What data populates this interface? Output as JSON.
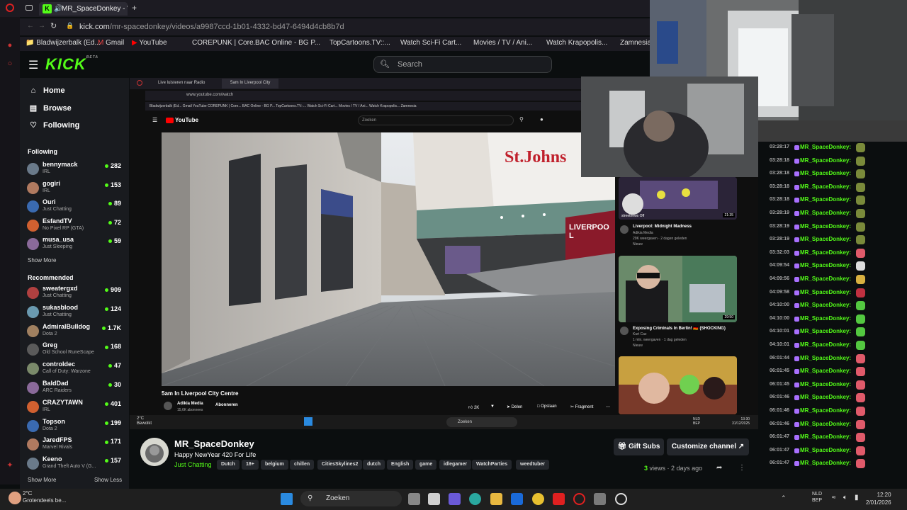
{
  "browser": {
    "tab_title": "MR_SpaceDonkey - W",
    "url_host": "kick.com",
    "url_path": "/mr-spacedonkey/videos/a9987ccd-1b01-4332-bd47-6494d4cb8b7d",
    "bookmarks": [
      "Bladwijzerbalk (Ed...",
      "Gmail",
      "YouTube",
      "COREPUNK | Core...",
      "BAC Online - BG P...",
      "TopCartoons.TV::...",
      "Watch Sci-Fi Cart...",
      "Movies / TV / Ani...",
      "Watch Krapopolis...",
      "Zamnesia |"
    ]
  },
  "header": {
    "logo": "KICK",
    "logo_badge": "BETA",
    "search_placeholder": "Search"
  },
  "sidebar": {
    "nav": [
      "Home",
      "Browse",
      "Following"
    ],
    "following_heading": "Following",
    "following": [
      {
        "name": "bennymack",
        "game": "IRL",
        "viewers": "282"
      },
      {
        "name": "gogiri",
        "game": "IRL",
        "viewers": "153"
      },
      {
        "name": "Ouri",
        "game": "Just Chatting",
        "viewers": "89"
      },
      {
        "name": "EsfandTV",
        "game": "No Pixel RP (GTA)",
        "viewers": "72"
      },
      {
        "name": "musa_usa",
        "game": "Just Sleeping",
        "viewers": "59"
      }
    ],
    "show_more": "Show More",
    "recommended_heading": "Recommended",
    "recommended": [
      {
        "name": "sweatergxd",
        "game": "Just Chatting",
        "viewers": "909"
      },
      {
        "name": "sukasblood",
        "game": "Just Chatting",
        "viewers": "124"
      },
      {
        "name": "AdmiralBulldog",
        "game": "Dota 2",
        "viewers": "1.7K"
      },
      {
        "name": "Greg",
        "game": "Old School RuneScape",
        "viewers": "168"
      },
      {
        "name": "controldec",
        "game": "Call of Duty: Warzone",
        "viewers": "47"
      },
      {
        "name": "BaldDad",
        "game": "ARC Raiders",
        "viewers": "30"
      },
      {
        "name": "CRAZYTAWN",
        "game": "IRL",
        "viewers": "401"
      },
      {
        "name": "Topson",
        "game": "Dota 2",
        "viewers": "199"
      },
      {
        "name": "JaredFPS",
        "game": "Marvel Rivals",
        "viewers": "171"
      },
      {
        "name": "Keeno",
        "game": "Grand Theft Auto V (G...",
        "viewers": "157"
      }
    ],
    "show_more_2": "Show More",
    "show_less": "Show Less"
  },
  "inner": {
    "tab1": "Live luisteren naar Radio",
    "tab2": "5am In Liverpool City",
    "url": "www.youtube.com/watch",
    "bookmarks": "Bladwijzerbalk (Ed...   Gmail   YouTube   COREPUNK | Core...   BAC Online - BG P...   TopCartoons.TV::...   Watch Sci-Fi Cart...   Movies / TV / Ani...   Watch Krapopolis...   Zamnesia",
    "yt_logo": "YouTube",
    "yt_search": "Zoeken",
    "video_title": "5am In Liverpool City Centre",
    "channel": "Adikia Media",
    "subs": "15,6K abonnees",
    "subscribe": "Abonneren",
    "likes": "2K",
    "share": "Delen",
    "save": "Opslaan",
    "clip": "Fragment",
    "sign_stjohns": "St.Johns",
    "sign_liverpool": "LIVERPOOL",
    "sugg1_title": "Liverpool: Midnight Madness",
    "sugg1_channel": "Adikia Media",
    "sugg1_meta": "29K weergaven · 2 dagen geleden",
    "sugg1_badge": "Nieuw",
    "sugg1_duration": "21:35",
    "sugg1_overlay": "streetnews Off",
    "sugg2_title": "Exposing Criminals In Berlin! 🇩🇪 (SHOCKING)",
    "sugg2_channel": "Kurt Caz",
    "sugg2_meta": "1 mln. weergaven · 1 dag geleden",
    "sugg2_badge": "Nieuw",
    "sugg2_duration": "29:50",
    "taskbar_search": "Zoeken",
    "weather": "2°C",
    "weather2": "Bewolkt",
    "clock": "13:30",
    "date": "31/12/2025",
    "lang": "NLD",
    "lang2": "BEP"
  },
  "channel": {
    "name": "MR_SpaceDonkey",
    "title": "Happy NewYear 420 For Life",
    "category": "Just Chatting",
    "tags": [
      "Dutch",
      "18+",
      "belgium",
      "chillen",
      "CitiesSkylines2",
      "dutch",
      "English",
      "game",
      "idlegamer",
      "WatchParties",
      "weedtuber"
    ],
    "gift_subs": "Gift Subs",
    "customize": "Customize channel",
    "views_count": "3",
    "views_label": "views",
    "age": "2 days ago"
  },
  "chat": [
    {
      "time": "03:28:17",
      "user": "MR_SpaceDonkey:",
      "emote_color": "#7a8a3a"
    },
    {
      "time": "03:28:18",
      "user": "MR_SpaceDonkey:",
      "emote_color": "#7a8a3a"
    },
    {
      "time": "03:28:18",
      "user": "MR_SpaceDonkey:",
      "emote_color": "#7a8a3a"
    },
    {
      "time": "03:28:18",
      "user": "MR_SpaceDonkey:",
      "emote_color": "#7a8a3a"
    },
    {
      "time": "03:28:18",
      "user": "MR_SpaceDonkey:",
      "emote_color": "#7a8a3a"
    },
    {
      "time": "03:28:19",
      "user": "MR_SpaceDonkey:",
      "emote_color": "#7a8a3a"
    },
    {
      "time": "03:28:19",
      "user": "MR_SpaceDonkey:",
      "emote_color": "#7a8a3a"
    },
    {
      "time": "03:28:19",
      "user": "MR_SpaceDonkey:",
      "emote_color": "#7a8a3a"
    },
    {
      "time": "03:32:03",
      "user": "MR_SpaceDonkey:",
      "emote_color": "#e05a6a"
    },
    {
      "time": "04:09:54",
      "user": "MR_SpaceDonkey:",
      "emote_color": "#dddddd"
    },
    {
      "time": "04:09:56",
      "user": "MR_SpaceDonkey:",
      "emote_color": "#d8b040"
    },
    {
      "time": "04:09:58",
      "user": "MR_SpaceDonkey:",
      "emote_color": "#c03040"
    },
    {
      "time": "04:10:00",
      "user": "MR_SpaceDonkey:",
      "emote_color": "#53c840"
    },
    {
      "time": "04:10:00",
      "user": "MR_SpaceDonkey:",
      "emote_color": "#53c840"
    },
    {
      "time": "04:10:01",
      "user": "MR_SpaceDonkey:",
      "emote_color": "#53c840"
    },
    {
      "time": "04:10:01",
      "user": "MR_SpaceDonkey:",
      "emote_color": "#53c840"
    },
    {
      "time": "06:01:44",
      "user": "MR_SpaceDonkey:",
      "emote_color": "#e05a6a"
    },
    {
      "time": "06:01:45",
      "user": "MR_SpaceDonkey:",
      "emote_color": "#e05a6a"
    },
    {
      "time": "06:01:45",
      "user": "MR_SpaceDonkey:",
      "emote_color": "#e05a6a"
    },
    {
      "time": "06:01:46",
      "user": "MR_SpaceDonkey:",
      "emote_color": "#e05a6a"
    },
    {
      "time": "06:01:46",
      "user": "MR_SpaceDonkey:",
      "emote_color": "#e05a6a"
    },
    {
      "time": "06:01:46",
      "user": "MR_SpaceDonkey:",
      "emote_color": "#e05a6a"
    },
    {
      "time": "06:01:47",
      "user": "MR_SpaceDonkey:",
      "emote_color": "#e05a6a"
    },
    {
      "time": "06:01:47",
      "user": "MR_SpaceDonkey:",
      "emote_color": "#e05a6a"
    },
    {
      "time": "06:01:47",
      "user": "MR_SpaceDonkey:",
      "emote_color": "#e05a6a"
    }
  ],
  "taskbar": {
    "temp": "2°C",
    "weather": "Grotendeels be...",
    "search": "Zoeken",
    "lang": "NLD",
    "lang2": "BEP",
    "time": "12:20",
    "date": "2/01/2026"
  },
  "colors": {
    "accent": "#53fc18",
    "background": "#0b0e0f",
    "panel": "#191b1f"
  }
}
